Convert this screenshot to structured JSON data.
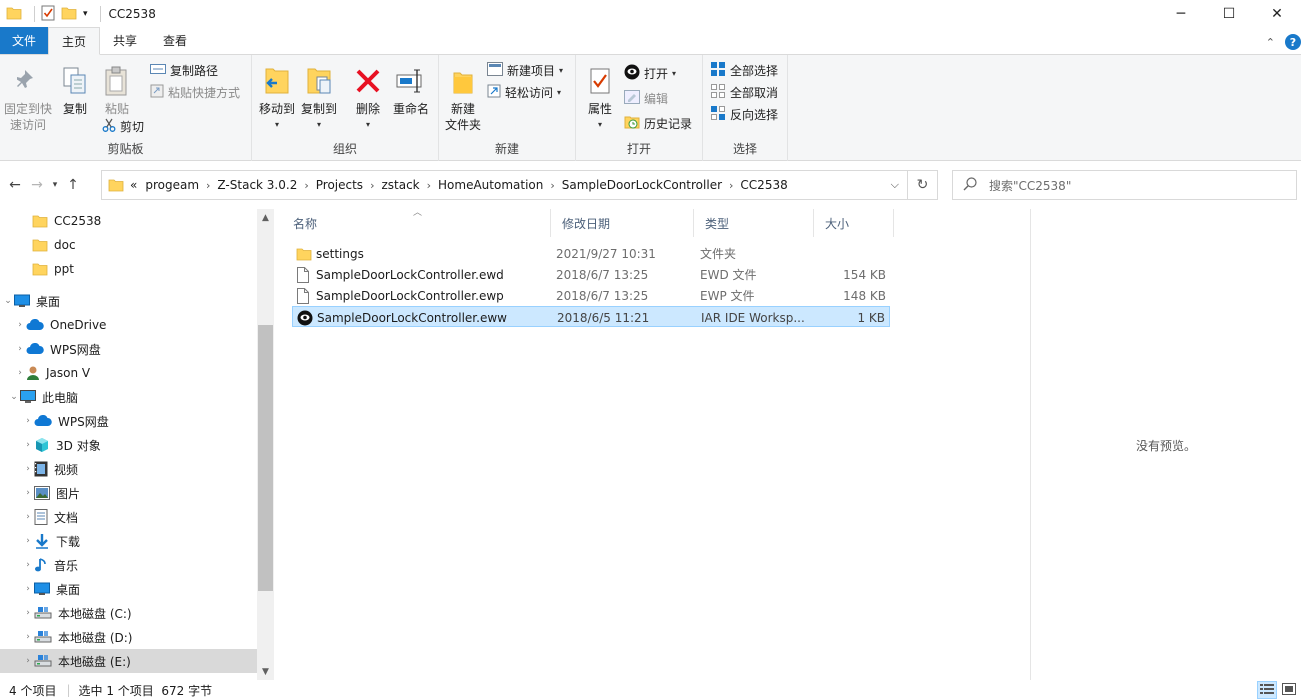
{
  "window": {
    "title": "CC2538",
    "minimize": "─",
    "maximize": "☐",
    "close": "✕"
  },
  "ribbon_tabs": [
    {
      "label": "文件"
    },
    {
      "label": "主页"
    },
    {
      "label": "共享"
    },
    {
      "label": "查看"
    }
  ],
  "ribbon": {
    "clipboard": {
      "label": "剪贴板",
      "pin_label_1": "固定到快",
      "pin_label_2": "速访问",
      "copy": "复制",
      "paste": "粘贴",
      "copy_path": "复制路径",
      "paste_shortcut": "粘贴快捷方式",
      "cut": "剪切"
    },
    "organize": {
      "label": "组织",
      "move_to": "移动到",
      "copy_to": "复制到",
      "delete": "删除",
      "rename": "重命名"
    },
    "new": {
      "label": "新建",
      "new_folder_1": "新建",
      "new_folder_2": "文件夹",
      "new_item": "新建项目",
      "easy_access": "轻松访问"
    },
    "open": {
      "label": "打开",
      "properties": "属性",
      "open": "打开",
      "edit": "编辑",
      "history": "历史记录"
    },
    "select": {
      "label": "选择",
      "select_all": "全部选择",
      "select_none": "全部取消",
      "invert": "反向选择"
    }
  },
  "address": {
    "overflow": "«",
    "breadcrumbs": [
      "progeam",
      "Z-Stack 3.0.2",
      "Projects",
      "zstack",
      "HomeAutomation",
      "SampleDoorLockController",
      "CC2538"
    ],
    "search_placeholder": "搜索\"CC2538\""
  },
  "nav_tree": [
    {
      "label": "CC2538",
      "icon": "folder-icon"
    },
    {
      "label": "doc",
      "icon": "folder-icon"
    },
    {
      "label": "ppt",
      "icon": "folder-icon"
    },
    {
      "label": "桌面",
      "icon": "desktop-icon"
    },
    {
      "label": "OneDrive",
      "icon": "cloud-icon"
    },
    {
      "label": "WPS网盘",
      "icon": "cloud-icon"
    },
    {
      "label": "Jason V",
      "icon": "user-icon"
    },
    {
      "label": "此电脑",
      "icon": "computer-icon"
    },
    {
      "label": "WPS网盘",
      "icon": "cloud-icon"
    },
    {
      "label": "3D 对象",
      "icon": "cube-icon"
    },
    {
      "label": "视频",
      "icon": "video-icon"
    },
    {
      "label": "图片",
      "icon": "pictures-icon"
    },
    {
      "label": "文档",
      "icon": "documents-icon"
    },
    {
      "label": "下载",
      "icon": "download-icon"
    },
    {
      "label": "音乐",
      "icon": "music-icon"
    },
    {
      "label": "桌面",
      "icon": "desktop-icon"
    },
    {
      "label": "本地磁盘 (C:)",
      "icon": "drive-icon"
    },
    {
      "label": "本地磁盘 (D:)",
      "icon": "drive-icon"
    },
    {
      "label": "本地磁盘 (E:)",
      "icon": "drive-icon"
    }
  ],
  "columns": [
    "名称",
    "修改日期",
    "类型",
    "大小"
  ],
  "files": [
    {
      "name": "settings",
      "date": "2021/9/27 10:31",
      "type": "文件夹",
      "size": "",
      "icon": "folder-icon"
    },
    {
      "name": "SampleDoorLockController.ewd",
      "date": "2018/6/7 13:25",
      "type": "EWD 文件",
      "size": "154 KB",
      "icon": "file-icon"
    },
    {
      "name": "SampleDoorLockController.ewp",
      "date": "2018/6/7 13:25",
      "type": "EWP 文件",
      "size": "148 KB",
      "icon": "file-icon"
    },
    {
      "name": "SampleDoorLockController.eww",
      "date": "2018/6/5 11:21",
      "type": "IAR IDE Worksp...",
      "size": "1 KB",
      "icon": "iar-workspace-icon"
    }
  ],
  "preview_text": "没有预览。",
  "status": {
    "item_count": "4 个项目",
    "selection": "选中 1 个项目  672 字节"
  },
  "colors": {
    "accent": "#1979ca",
    "selection_bg": "#cce8ff",
    "selection_border": "#99d1ff",
    "folder": "#ffd45e"
  }
}
